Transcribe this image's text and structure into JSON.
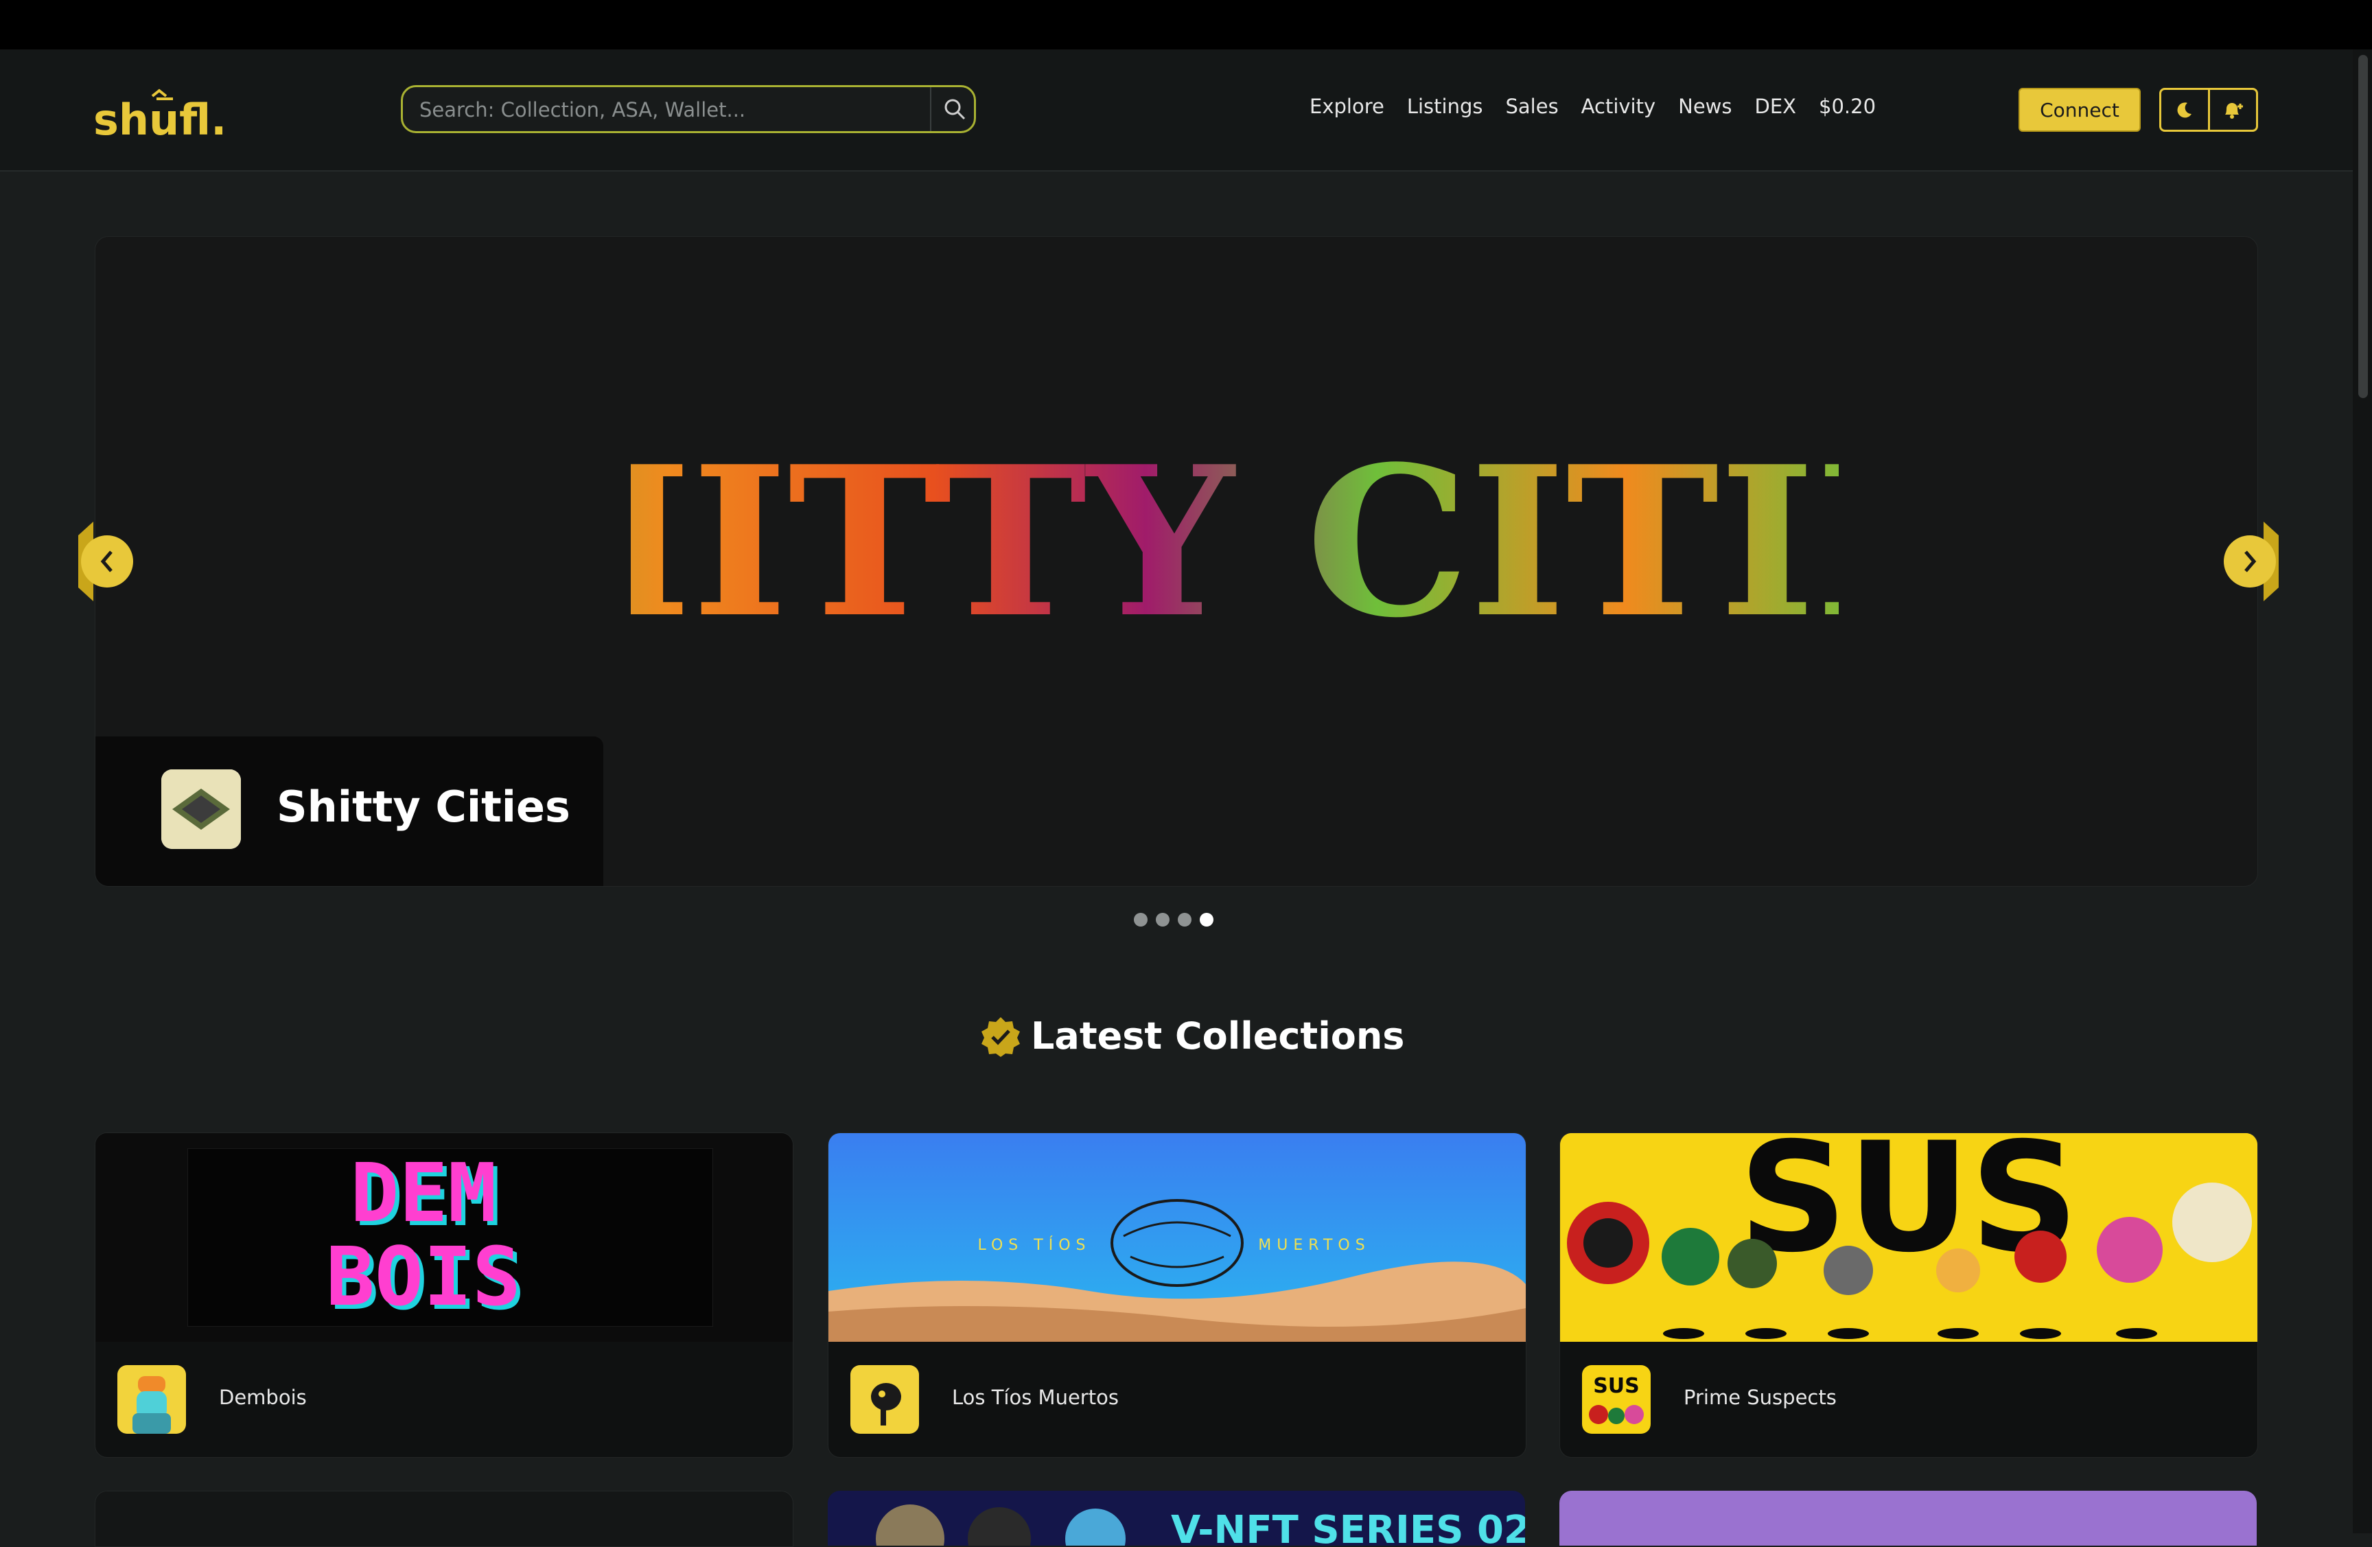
{
  "brand": {
    "logo_text": "shufl."
  },
  "search": {
    "placeholder": "Search: Collection, ASA, Wallet..."
  },
  "nav": {
    "items": [
      "Explore",
      "Listings",
      "Sales",
      "Activity",
      "News",
      "DEX",
      "$0.20"
    ]
  },
  "header": {
    "connect_label": "Connect"
  },
  "hero": {
    "banner_text": "SHITTY CITIES",
    "title": "Shitty Cities",
    "slide_count": 4,
    "active_slide": 4
  },
  "sections": {
    "latest_title": "Latest Collections"
  },
  "collections": [
    {
      "name": "Dembois",
      "banner_text": [
        "DEM",
        "BOIS"
      ]
    },
    {
      "name": "Los Tíos Muertos",
      "banner_text": [
        "LOS TÍOS",
        "MUERTOS"
      ]
    },
    {
      "name": "Prime Suspects",
      "banner_text": [
        "SUS"
      ]
    }
  ],
  "next_row": {
    "partial_banner_text": "V-NFT SERIES 02"
  },
  "colors": {
    "accent": "#e8c83a",
    "background": "#1a1d1d",
    "header": "#141717",
    "card": "#0f1111"
  }
}
